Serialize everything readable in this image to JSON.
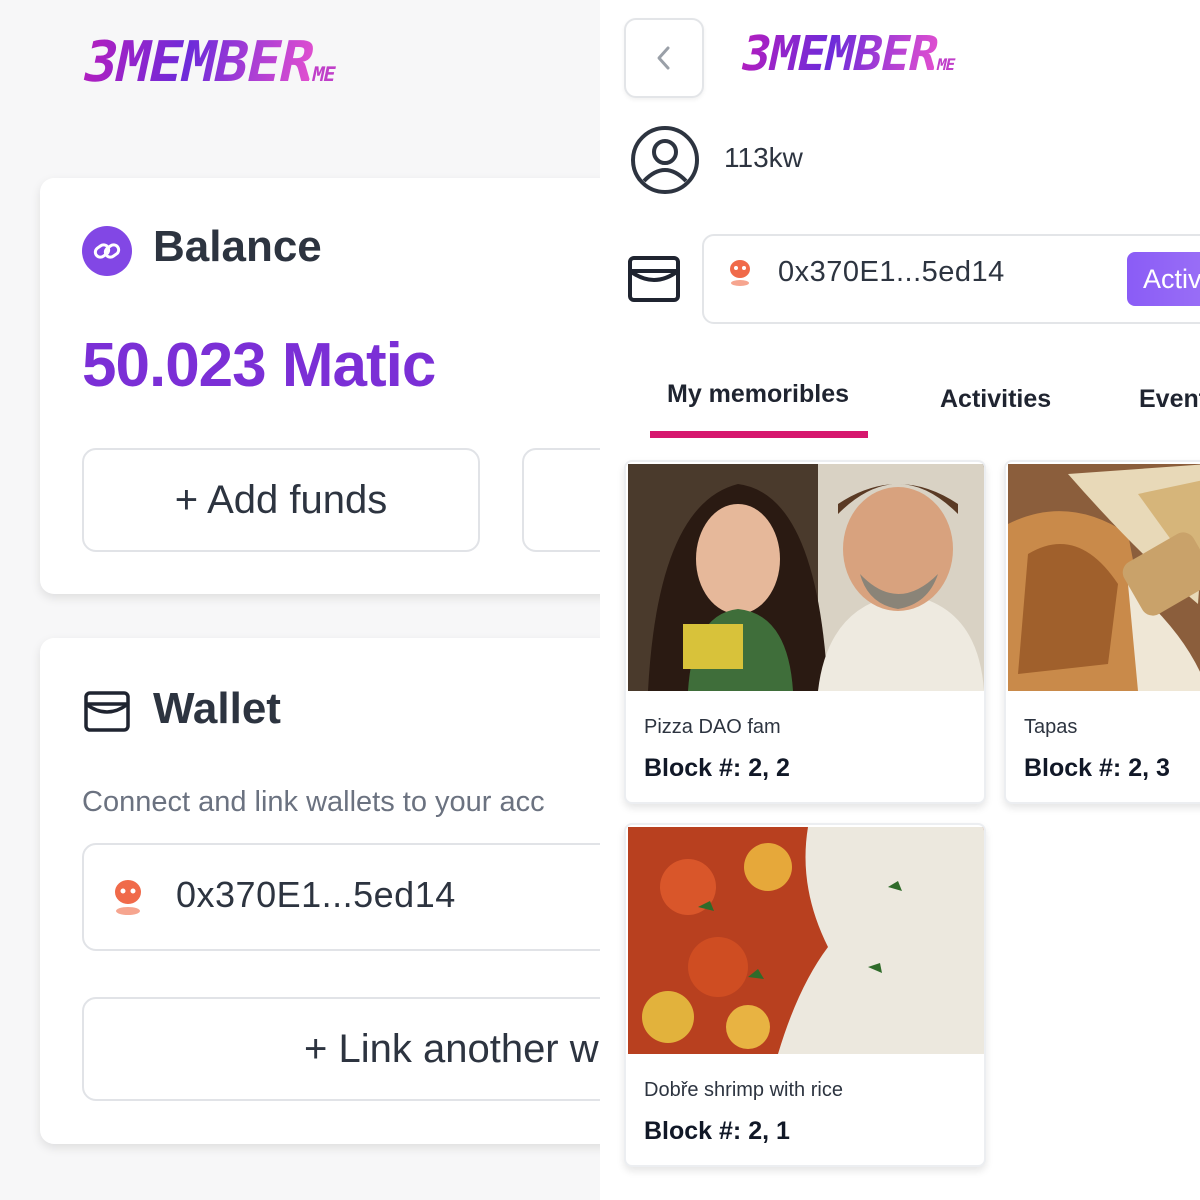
{
  "brand": {
    "logo_main": "3MEMBER",
    "logo_suffix": "ME"
  },
  "balance": {
    "title": "Balance",
    "amount": "50.023 Matic",
    "add_funds_label": "+ Add funds"
  },
  "wallet": {
    "title": "Wallet",
    "description": "Connect and link wallets to your acc",
    "address": "0x370E1...5ed14",
    "link_label": "+ Link another w"
  },
  "profile": {
    "username": "113kw",
    "address": "0x370E1...5ed14",
    "status_badge": "Activ"
  },
  "tabs": [
    {
      "label": "My memoribles",
      "active": true
    },
    {
      "label": "Activities",
      "active": false
    },
    {
      "label": "Event",
      "active": false
    }
  ],
  "memoribles": [
    {
      "title": "Pizza DAO fam",
      "block": "Block #: 2, 2"
    },
    {
      "title": "Tapas",
      "block": "Block #: 2, 3"
    },
    {
      "title": "Dobře shrimp with rice",
      "block": "Block #: 2, 1"
    }
  ],
  "colors": {
    "accent_purple": "#7b2fd6",
    "polygon": "#8247e5",
    "tab_underline": "#d6176e",
    "badge": "#8a5cf6"
  }
}
